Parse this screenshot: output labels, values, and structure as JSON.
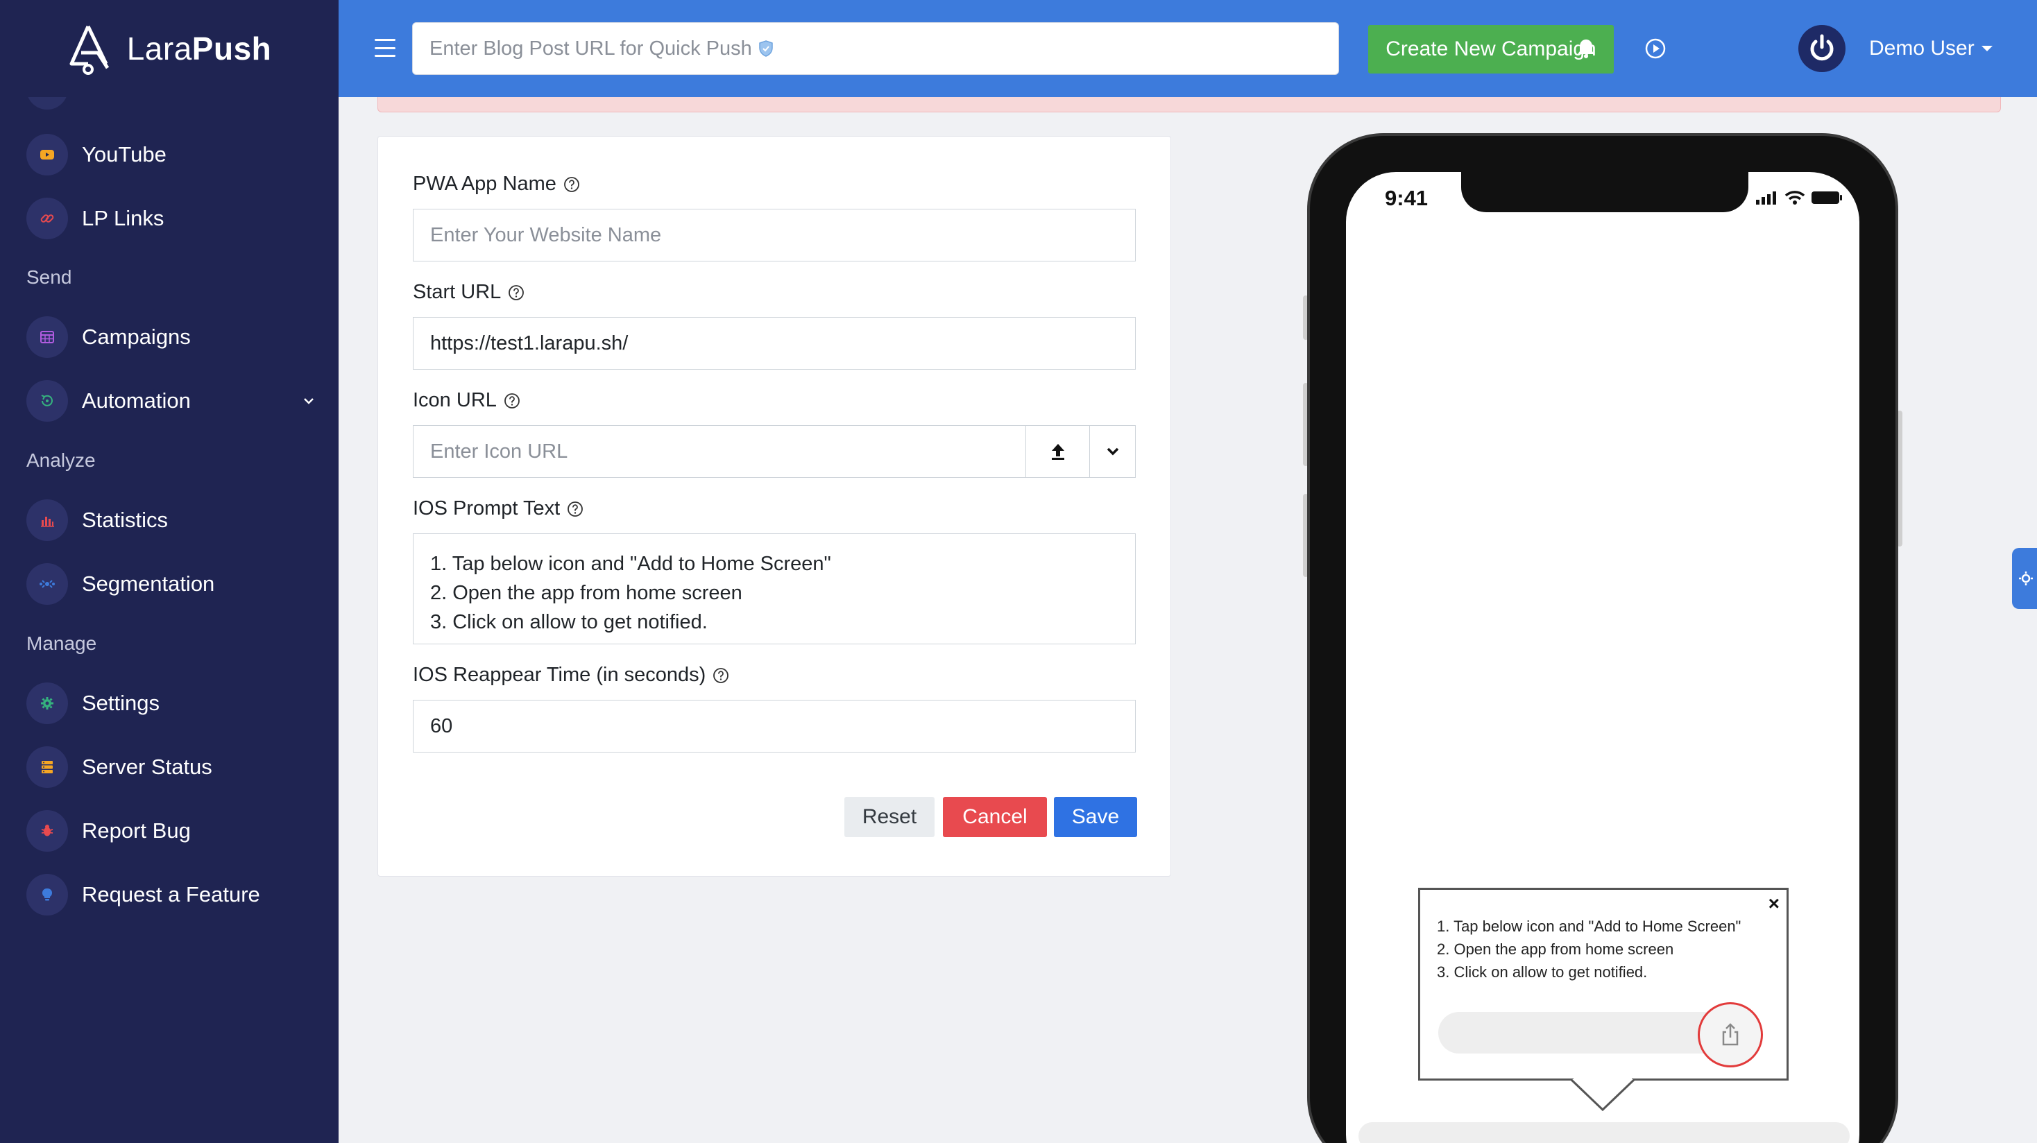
{
  "brand": {
    "name_light": "Lara",
    "name_bold": "Push"
  },
  "sidebar": {
    "items": [
      {
        "label": "YouTube",
        "icon": "youtube-icon",
        "color": "#f5a623"
      },
      {
        "label": "LP Links",
        "icon": "link-icon",
        "color": "#e84a4f"
      },
      {
        "label": "Campaigns",
        "icon": "calendar-grid-icon",
        "color": "#b15ce0"
      },
      {
        "label": "Automation",
        "icon": "automation-icon",
        "color": "#35b37e"
      },
      {
        "label": "Statistics",
        "icon": "bar-chart-icon",
        "color": "#e84a4f"
      },
      {
        "label": "Segmentation",
        "icon": "segmentation-icon",
        "color": "#3d7bdc"
      },
      {
        "label": "Settings",
        "icon": "gear-icon",
        "color": "#35b37e"
      },
      {
        "label": "Server Status",
        "icon": "server-icon",
        "color": "#f5a623"
      },
      {
        "label": "Report Bug",
        "icon": "bug-icon",
        "color": "#e84a4f"
      },
      {
        "label": "Request a Feature",
        "icon": "lightbulb-icon",
        "color": "#3d7bdc"
      }
    ],
    "sections": {
      "send": "Send",
      "analyze": "Analyze",
      "manage": "Manage"
    }
  },
  "topbar": {
    "quick_push_placeholder": "Enter Blog Post URL for Quick Push",
    "create_campaign": "Create New Campaign",
    "user_name": "Demo User"
  },
  "form": {
    "pwa_app_name": {
      "label": "PWA App Name",
      "placeholder": "Enter Your Website Name"
    },
    "start_url": {
      "label": "Start URL",
      "value": "https://test1.larapu.sh/"
    },
    "icon_url": {
      "label": "Icon URL",
      "placeholder": "Enter Icon URL"
    },
    "ios_prompt_text": {
      "label": "IOS Prompt Text",
      "lines": [
        "1. Tap below icon and \"Add to Home Screen\"",
        "2. Open the app from home screen",
        "3. Click on allow to get notified."
      ]
    },
    "ios_reappear_time": {
      "label": "IOS Reappear Time (in seconds)",
      "value": "60"
    },
    "buttons": {
      "reset": "Reset",
      "cancel": "Cancel",
      "save": "Save"
    }
  },
  "preview": {
    "time": "9:41",
    "close": "×",
    "prompt_lines": [
      "1. Tap below icon and \"Add to Home Screen\"",
      "2. Open the app from home screen",
      "3. Click on allow to get notified."
    ]
  },
  "colors": {
    "sidebar_bg": "#1f2452",
    "topbar_bg": "#3d7bdc",
    "campaign_button": "#4caf50",
    "cancel_button": "#e84a4f",
    "save_button": "#2f72e3"
  }
}
